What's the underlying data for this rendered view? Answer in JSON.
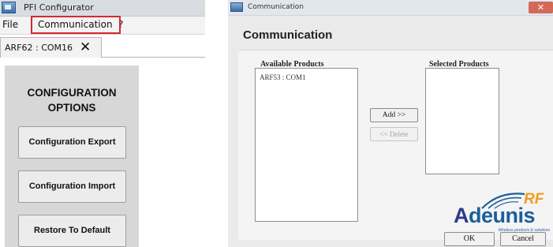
{
  "left_window": {
    "title": "PFI Configurator",
    "menu": {
      "file": "File",
      "communication": "Communication",
      "help": "?"
    },
    "tab": {
      "label": "ARF62 : COM16",
      "close_glyph": "✕"
    },
    "options": {
      "heading_line1": "CONFIGURATION",
      "heading_line2": "OPTIONS",
      "buttons": {
        "export": "Configuration Export",
        "import": "Configuration Import",
        "restore": "Restore To Default"
      }
    },
    "highlight_color": "#d9272c"
  },
  "dialog": {
    "title": "Communication",
    "close_glyph": "✕",
    "heading": "Communication",
    "available_label": "Available Products",
    "selected_label": "Selected Products",
    "available_items": [
      "ARF53 : COM1"
    ],
    "selected_items": [],
    "add_button": "Add >>",
    "delete_button": "<< Delete",
    "ok_button": "OK",
    "cancel_button": "Cancel",
    "logo": {
      "word_first": "A",
      "word_rest": "deunis",
      "rf": "RF",
      "tagline": "Wireless products & solutions"
    }
  },
  "icons": [
    "app-icon",
    "close-icon",
    "dialog-icon",
    "adeunis-logo"
  ],
  "colors": {
    "brand_blue": "#1c5e9c",
    "brand_orange": "#f39a1e",
    "dialog_close": "#d36a58"
  }
}
